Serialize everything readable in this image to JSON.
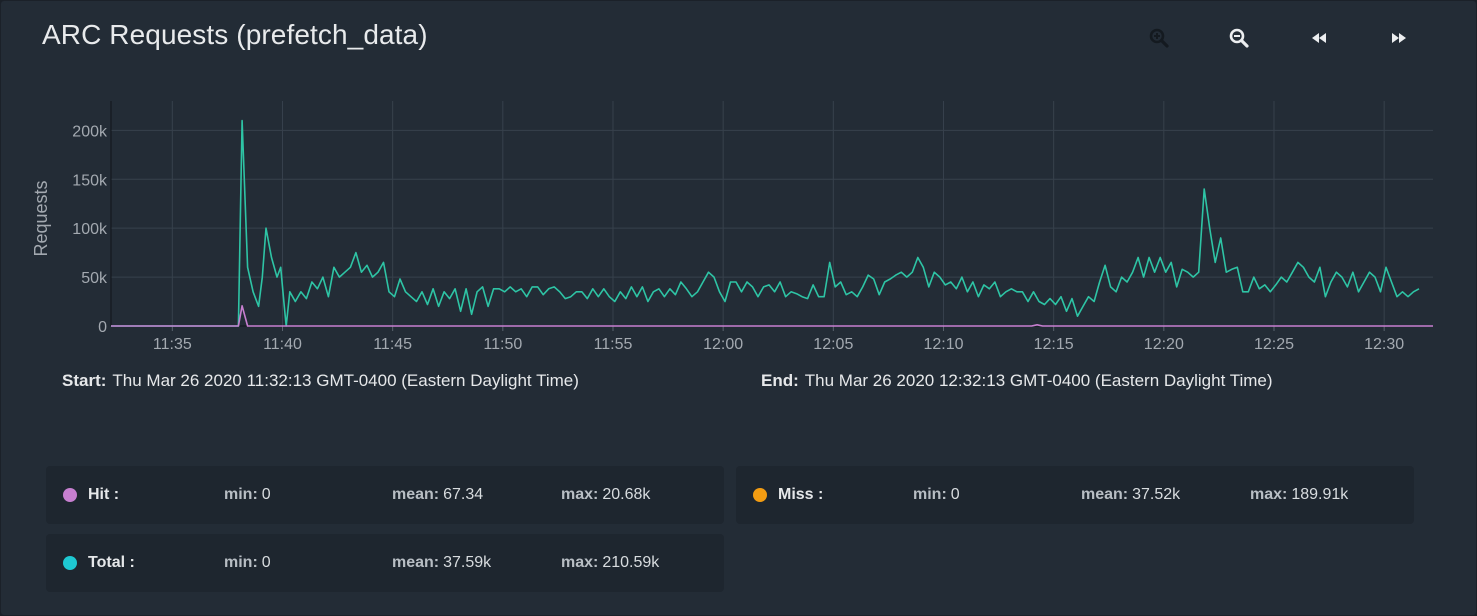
{
  "title": "ARC Requests (prefetch_data)",
  "toolbar": {
    "zoom_in_icon": "zoom-in-icon",
    "zoom_out_icon": "zoom-out-icon",
    "rewind_icon": "rewind-icon",
    "fast_forward_icon": "fast-forward-icon"
  },
  "range": {
    "start_label": "Start:",
    "start_value": "Thu Mar 26 2020 11:32:13 GMT-0400 (Eastern Daylight Time)",
    "end_label": "End:",
    "end_value": "Thu Mar 26 2020 12:32:13 GMT-0400 (Eastern Daylight Time)"
  },
  "legend": [
    {
      "name": "Hit :",
      "color": "#c77fd0",
      "min_label": "min:",
      "min": "0",
      "mean_label": "mean:",
      "mean": "67.34",
      "max_label": "max:",
      "max": "20.68k"
    },
    {
      "name": "Miss :",
      "color": "#f39c12",
      "min_label": "min:",
      "min": "0",
      "mean_label": "mean:",
      "mean": "37.52k",
      "max_label": "max:",
      "max": "189.91k"
    },
    {
      "name": "Total :",
      "color": "#1ec8d2",
      "min_label": "min:",
      "min": "0",
      "mean_label": "mean:",
      "mean": "37.59k",
      "max_label": "max:",
      "max": "210.59k"
    }
  ],
  "chart_data": {
    "type": "line",
    "title": "ARC Requests (prefetch_data)",
    "xlabel": "",
    "ylabel": "Requests",
    "xlim": [
      "11:32:13",
      "12:32:13"
    ],
    "ylim": [
      0,
      230000
    ],
    "grid": true,
    "legend_placement": "bottom",
    "xticks": [
      "11:35",
      "11:40",
      "11:45",
      "11:50",
      "11:55",
      "12:00",
      "12:05",
      "12:10",
      "12:15",
      "12:20",
      "12:25",
      "12:30"
    ],
    "yticks": [
      {
        "value": 0,
        "label": "0"
      },
      {
        "value": 50000,
        "label": "50k"
      },
      {
        "value": 100000,
        "label": "100k"
      },
      {
        "value": 150000,
        "label": "150k"
      },
      {
        "value": 200000,
        "label": "200k"
      }
    ],
    "series": [
      {
        "name": "Total",
        "color": "#2ec4a5",
        "points": [
          [
            "11:32:13",
            0
          ],
          [
            "11:38:00",
            0
          ],
          [
            "11:38:10",
            210000
          ],
          [
            "11:38:25",
            60000
          ],
          [
            "11:38:40",
            35000
          ],
          [
            "11:38:55",
            20000
          ],
          [
            "11:39:05",
            50000
          ],
          [
            "11:39:15",
            100000
          ],
          [
            "11:39:30",
            70000
          ],
          [
            "11:39:45",
            50000
          ],
          [
            "11:39:55",
            60000
          ],
          [
            "11:40:05",
            20000
          ],
          [
            "11:40:10",
            0
          ],
          [
            "11:40:20",
            35000
          ],
          [
            "11:40:35",
            25000
          ],
          [
            "11:40:50",
            35000
          ],
          [
            "11:41:05",
            28000
          ],
          [
            "11:41:20",
            45000
          ],
          [
            "11:41:35",
            38000
          ],
          [
            "11:41:50",
            50000
          ],
          [
            "11:42:05",
            30000
          ],
          [
            "11:42:20",
            60000
          ],
          [
            "11:42:35",
            50000
          ],
          [
            "11:42:50",
            55000
          ],
          [
            "11:43:05",
            60000
          ],
          [
            "11:43:20",
            75000
          ],
          [
            "11:43:35",
            55000
          ],
          [
            "11:43:50",
            62000
          ],
          [
            "11:44:05",
            50000
          ],
          [
            "11:44:20",
            55000
          ],
          [
            "11:44:35",
            65000
          ],
          [
            "11:44:50",
            35000
          ],
          [
            "11:45:05",
            30000
          ],
          [
            "11:45:20",
            48000
          ],
          [
            "11:45:35",
            35000
          ],
          [
            "11:45:50",
            30000
          ],
          [
            "11:46:05",
            25000
          ],
          [
            "11:46:20",
            35000
          ],
          [
            "11:46:35",
            22000
          ],
          [
            "11:46:50",
            38000
          ],
          [
            "11:47:05",
            20000
          ],
          [
            "11:47:20",
            35000
          ],
          [
            "11:47:35",
            28000
          ],
          [
            "11:47:50",
            38000
          ],
          [
            "11:48:05",
            15000
          ],
          [
            "11:48:20",
            38000
          ],
          [
            "11:48:35",
            12000
          ],
          [
            "11:48:50",
            35000
          ],
          [
            "11:49:05",
            40000
          ],
          [
            "11:49:20",
            20000
          ],
          [
            "11:49:35",
            38000
          ],
          [
            "11:49:50",
            38000
          ],
          [
            "11:50:05",
            35000
          ],
          [
            "11:50:20",
            40000
          ],
          [
            "11:50:35",
            35000
          ],
          [
            "11:50:50",
            38000
          ],
          [
            "11:51:05",
            30000
          ],
          [
            "11:51:20",
            40000
          ],
          [
            "11:51:35",
            40000
          ],
          [
            "11:51:50",
            32000
          ],
          [
            "11:52:05",
            38000
          ],
          [
            "11:52:20",
            40000
          ],
          [
            "11:52:35",
            35000
          ],
          [
            "11:52:50",
            28000
          ],
          [
            "11:53:05",
            30000
          ],
          [
            "11:53:20",
            35000
          ],
          [
            "11:53:35",
            35000
          ],
          [
            "11:53:50",
            28000
          ],
          [
            "11:54:05",
            38000
          ],
          [
            "11:54:20",
            30000
          ],
          [
            "11:54:35",
            38000
          ],
          [
            "11:54:50",
            30000
          ],
          [
            "11:55:05",
            25000
          ],
          [
            "11:55:20",
            35000
          ],
          [
            "11:55:35",
            28000
          ],
          [
            "11:55:50",
            40000
          ],
          [
            "11:56:05",
            30000
          ],
          [
            "11:56:20",
            40000
          ],
          [
            "11:56:35",
            25000
          ],
          [
            "11:56:50",
            35000
          ],
          [
            "11:57:05",
            38000
          ],
          [
            "11:57:20",
            30000
          ],
          [
            "11:57:35",
            38000
          ],
          [
            "11:57:50",
            32000
          ],
          [
            "11:58:05",
            45000
          ],
          [
            "11:58:20",
            38000
          ],
          [
            "11:58:35",
            30000
          ],
          [
            "11:58:50",
            35000
          ],
          [
            "11:59:05",
            45000
          ],
          [
            "11:59:20",
            55000
          ],
          [
            "11:59:35",
            50000
          ],
          [
            "11:59:50",
            35000
          ],
          [
            "12:00:05",
            25000
          ],
          [
            "12:00:20",
            45000
          ],
          [
            "12:00:35",
            45000
          ],
          [
            "12:00:50",
            35000
          ],
          [
            "12:01:05",
            45000
          ],
          [
            "12:01:20",
            40000
          ],
          [
            "12:01:35",
            30000
          ],
          [
            "12:01:50",
            40000
          ],
          [
            "12:02:05",
            42000
          ],
          [
            "12:02:20",
            35000
          ],
          [
            "12:02:35",
            45000
          ],
          [
            "12:02:50",
            30000
          ],
          [
            "12:03:05",
            35000
          ],
          [
            "12:03:20",
            33000
          ],
          [
            "12:03:35",
            30000
          ],
          [
            "12:03:50",
            28000
          ],
          [
            "12:04:05",
            42000
          ],
          [
            "12:04:20",
            30000
          ],
          [
            "12:04:35",
            30000
          ],
          [
            "12:04:50",
            65000
          ],
          [
            "12:05:05",
            40000
          ],
          [
            "12:05:20",
            45000
          ],
          [
            "12:05:35",
            32000
          ],
          [
            "12:05:50",
            35000
          ],
          [
            "12:06:05",
            30000
          ],
          [
            "12:06:20",
            40000
          ],
          [
            "12:06:35",
            52000
          ],
          [
            "12:06:50",
            48000
          ],
          [
            "12:07:05",
            32000
          ],
          [
            "12:07:20",
            45000
          ],
          [
            "12:07:35",
            48000
          ],
          [
            "12:07:50",
            52000
          ],
          [
            "12:08:05",
            55000
          ],
          [
            "12:08:20",
            50000
          ],
          [
            "12:08:35",
            55000
          ],
          [
            "12:08:50",
            70000
          ],
          [
            "12:09:05",
            60000
          ],
          [
            "12:09:20",
            40000
          ],
          [
            "12:09:35",
            55000
          ],
          [
            "12:09:50",
            50000
          ],
          [
            "12:10:05",
            42000
          ],
          [
            "12:10:20",
            45000
          ],
          [
            "12:10:35",
            38000
          ],
          [
            "12:10:50",
            50000
          ],
          [
            "12:11:05",
            35000
          ],
          [
            "12:11:20",
            45000
          ],
          [
            "12:11:35",
            30000
          ],
          [
            "12:11:50",
            42000
          ],
          [
            "12:12:05",
            38000
          ],
          [
            "12:12:20",
            45000
          ],
          [
            "12:12:35",
            30000
          ],
          [
            "12:12:50",
            35000
          ],
          [
            "12:13:05",
            38000
          ],
          [
            "12:13:20",
            35000
          ],
          [
            "12:13:35",
            35000
          ],
          [
            "12:13:50",
            25000
          ],
          [
            "12:14:05",
            35000
          ],
          [
            "12:14:20",
            25000
          ],
          [
            "12:14:35",
            22000
          ],
          [
            "12:14:50",
            28000
          ],
          [
            "12:15:05",
            22000
          ],
          [
            "12:15:20",
            30000
          ],
          [
            "12:15:35",
            15000
          ],
          [
            "12:15:50",
            28000
          ],
          [
            "12:16:05",
            10000
          ],
          [
            "12:16:20",
            20000
          ],
          [
            "12:16:35",
            30000
          ],
          [
            "12:16:50",
            25000
          ],
          [
            "12:17:05",
            45000
          ],
          [
            "12:17:20",
            62000
          ],
          [
            "12:17:35",
            40000
          ],
          [
            "12:17:50",
            35000
          ],
          [
            "12:18:05",
            50000
          ],
          [
            "12:18:20",
            45000
          ],
          [
            "12:18:35",
            55000
          ],
          [
            "12:18:50",
            70000
          ],
          [
            "12:19:05",
            50000
          ],
          [
            "12:19:20",
            70000
          ],
          [
            "12:19:35",
            55000
          ],
          [
            "12:19:50",
            70000
          ],
          [
            "12:20:05",
            55000
          ],
          [
            "12:20:20",
            65000
          ],
          [
            "12:20:35",
            40000
          ],
          [
            "12:20:50",
            58000
          ],
          [
            "12:21:05",
            55000
          ],
          [
            "12:21:20",
            50000
          ],
          [
            "12:21:35",
            55000
          ],
          [
            "12:21:50",
            140000
          ],
          [
            "12:22:05",
            100000
          ],
          [
            "12:22:20",
            65000
          ],
          [
            "12:22:35",
            90000
          ],
          [
            "12:22:50",
            55000
          ],
          [
            "12:23:05",
            58000
          ],
          [
            "12:23:20",
            60000
          ],
          [
            "12:23:35",
            35000
          ],
          [
            "12:23:50",
            35000
          ],
          [
            "12:24:05",
            50000
          ],
          [
            "12:24:20",
            38000
          ],
          [
            "12:24:35",
            42000
          ],
          [
            "12:24:50",
            35000
          ],
          [
            "12:25:05",
            42000
          ],
          [
            "12:25:20",
            50000
          ],
          [
            "12:25:35",
            45000
          ],
          [
            "12:25:50",
            55000
          ],
          [
            "12:26:05",
            65000
          ],
          [
            "12:26:20",
            60000
          ],
          [
            "12:26:35",
            50000
          ],
          [
            "12:26:50",
            45000
          ],
          [
            "12:27:05",
            60000
          ],
          [
            "12:27:20",
            30000
          ],
          [
            "12:27:35",
            45000
          ],
          [
            "12:27:50",
            55000
          ],
          [
            "12:28:05",
            50000
          ],
          [
            "12:28:20",
            40000
          ],
          [
            "12:28:35",
            55000
          ],
          [
            "12:28:50",
            35000
          ],
          [
            "12:29:05",
            45000
          ],
          [
            "12:29:20",
            55000
          ],
          [
            "12:29:35",
            50000
          ],
          [
            "12:29:50",
            35000
          ],
          [
            "12:30:05",
            60000
          ],
          [
            "12:30:20",
            45000
          ],
          [
            "12:30:35",
            30000
          ],
          [
            "12:30:50",
            35000
          ],
          [
            "12:31:05",
            30000
          ],
          [
            "12:31:20",
            35000
          ],
          [
            "12:31:35",
            38000
          ]
        ]
      },
      {
        "name": "Hit",
        "color": "#c77fd0",
        "points": [
          [
            "11:32:13",
            0
          ],
          [
            "11:38:00",
            0
          ],
          [
            "11:38:10",
            20680
          ],
          [
            "11:38:25",
            0
          ],
          [
            "12:14:00",
            0
          ],
          [
            "12:14:15",
            1200
          ],
          [
            "12:14:30",
            0
          ],
          [
            "12:32:13",
            0
          ]
        ]
      }
    ]
  }
}
